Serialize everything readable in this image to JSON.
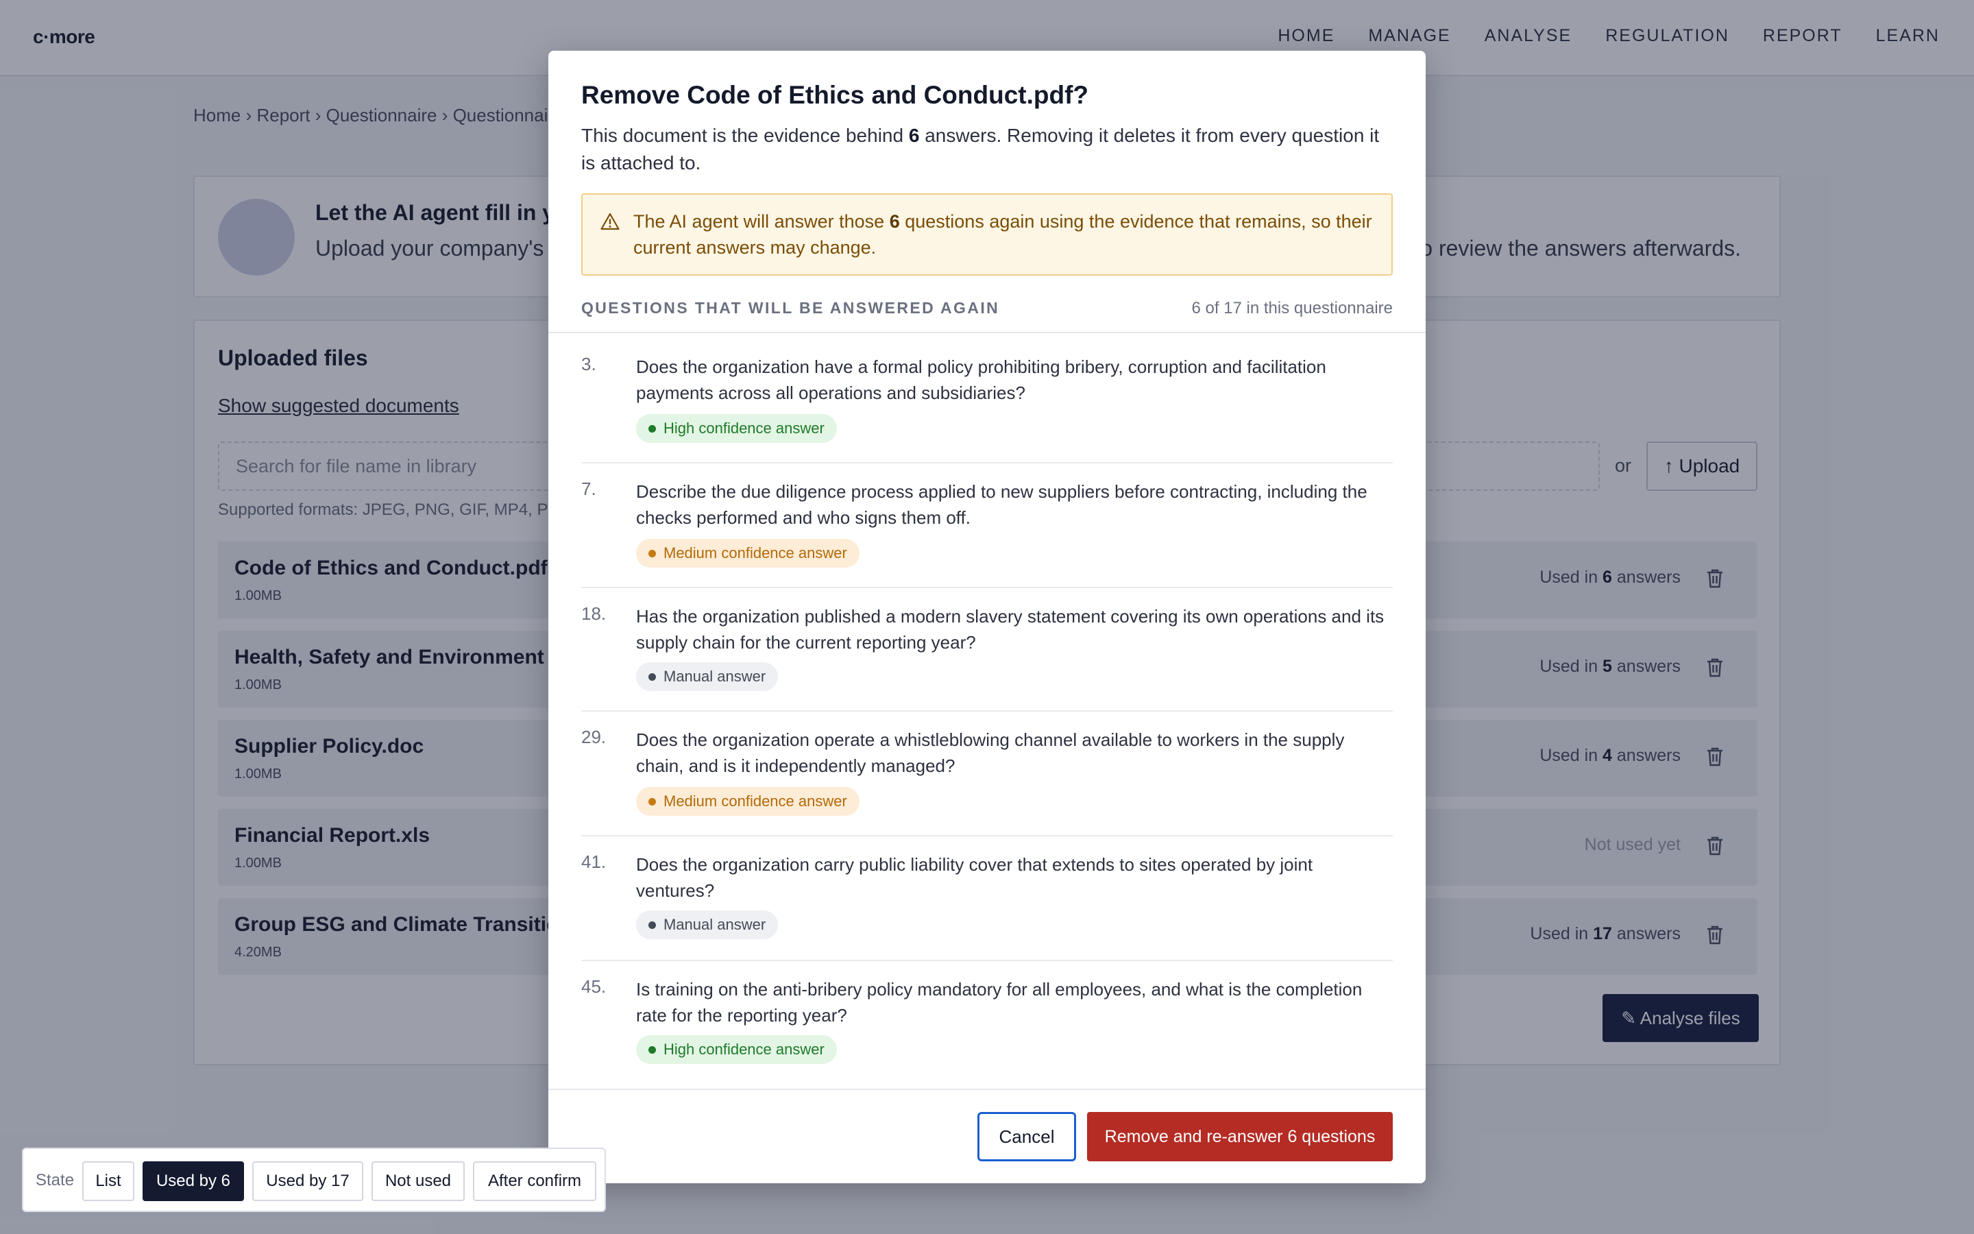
{
  "app": {
    "logo": "c·more",
    "nav": [
      "HOME",
      "MANAGE",
      "ANALYSE",
      "REGULATION",
      "REPORT",
      "LEARN"
    ]
  },
  "breadcrumb": "Home › Report › Questionnaire › Questionnai",
  "agent_card": {
    "title": "Let the AI agent fill in y",
    "desc_start": "Upload your company's",
    "desc_end": "o review the answers afterwards."
  },
  "files": {
    "title": "Uploaded files",
    "suggest_link": "Show suggested documents",
    "search_placeholder": "Search for file name in library",
    "or_label": "or",
    "upload_label": "↑ Upload",
    "formats": "Supported formats: JPEG, PNG, GIF, MP4, P",
    "rows": [
      {
        "name": "Code of Ethics and Conduct.pdf",
        "size": "1.00MB",
        "used_prefix": "Used in ",
        "used_count": "6",
        "used_suffix": " answers"
      },
      {
        "name": "Health, Safety and Environment Po",
        "size": "1.00MB",
        "used_prefix": "Used in ",
        "used_count": "5",
        "used_suffix": " answers"
      },
      {
        "name": "Supplier Policy.doc",
        "size": "1.00MB",
        "used_prefix": "Used in ",
        "used_count": "4",
        "used_suffix": " answers"
      },
      {
        "name": "Financial Report.xls",
        "size": "1.00MB",
        "used_prefix": "Not used yet",
        "used_count": "",
        "used_suffix": ""
      },
      {
        "name": "Group ESG and Climate Transition",
        "size": "4.20MB",
        "used_prefix": "Used in ",
        "used_count": "17",
        "used_suffix": " answers"
      }
    ],
    "analyse_label": "✎ Analyse files"
  },
  "modal": {
    "title": "Remove Code of Ethics and Conduct.pdf?",
    "desc_pre": "This document is the evidence behind ",
    "desc_count": "6",
    "desc_post": " answers. Removing it deletes it from every question it is attached to.",
    "warning_pre": "The AI agent will answer those ",
    "warning_count": "6",
    "warning_post": " questions again using the evidence that remains, so their current answers may change.",
    "questions_heading": "QUESTIONS THAT WILL BE ANSWERED AGAIN",
    "questions_count": "6 of 17 in this questionnaire",
    "questions": [
      {
        "num": "3.",
        "text": "Does the organization have a formal policy prohibiting bribery, corruption and facilitation payments across all operations and subsidiaries?",
        "badge": "High confidence answer",
        "level": "high"
      },
      {
        "num": "7.",
        "text": "Describe the due diligence process applied to new suppliers before contracting, including the checks performed and who signs them off.",
        "badge": "Medium confidence answer",
        "level": "medium"
      },
      {
        "num": "18.",
        "text": "Has the organization published a modern slavery statement covering its own operations and its supply chain for the current reporting year?",
        "badge": "Manual answer",
        "level": "manual"
      },
      {
        "num": "29.",
        "text": "Does the organization operate a whistleblowing channel available to workers in the supply chain, and is it independently managed?",
        "badge": "Medium confidence answer",
        "level": "medium"
      },
      {
        "num": "41.",
        "text": "Does the organization carry public liability cover that extends to sites operated by joint ventures?",
        "badge": "Manual answer",
        "level": "manual"
      },
      {
        "num": "45.",
        "text": "Is training on the anti-bribery policy mandatory for all employees, and what is the completion rate for the reporting year?",
        "badge": "High confidence answer",
        "level": "high"
      }
    ],
    "cancel_label": "Cancel",
    "confirm_label": "Remove and re-answer 6 questions"
  },
  "state_switcher": {
    "label": "State",
    "options": [
      "List",
      "Used by 6",
      "Used by 17",
      "Not used",
      "After confirm"
    ],
    "active": "Used by 6"
  }
}
